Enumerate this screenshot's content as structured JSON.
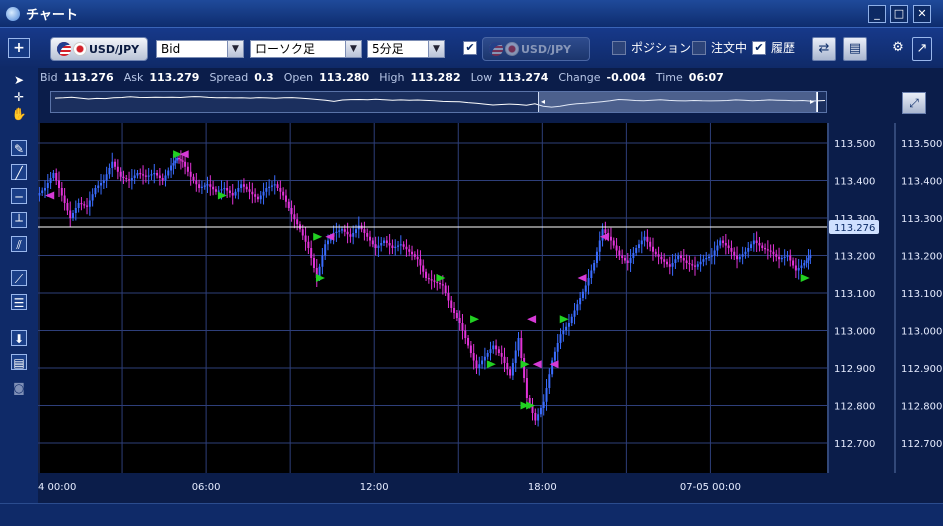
{
  "window": {
    "title": "チャート",
    "controls": [
      "_",
      "□",
      "✕"
    ]
  },
  "toolbar": {
    "add_label": "+",
    "pair_label": "USD/JPY",
    "compare_pair_label": "USD/JPY",
    "price_type": "Bid",
    "chart_type": "ローソク足",
    "timeframe": "5分足",
    "compare_checked": true,
    "position_label": "ポジション",
    "order_label": "注文中",
    "history_label": "履歴",
    "position_checked": false,
    "order_checked": false,
    "history_checked": true
  },
  "quote": {
    "bid_label": "Bid",
    "bid": "113.276",
    "ask_label": "Ask",
    "ask": "113.279",
    "spread_label": "Spread",
    "spread": "0.3",
    "open_label": "Open",
    "open": "113.280",
    "high_label": "High",
    "high": "113.282",
    "low_label": "Low",
    "low": "113.274",
    "change_label": "Change",
    "change": "-0.004",
    "time_label": "Time",
    "time": "06:07"
  },
  "colors": {
    "up_candle": "#3a6cff",
    "down_candle": "#e233d8",
    "buy_marker": "#22d022",
    "sell_marker": "#d63ad6",
    "grid": "#2e3f7a",
    "price_line": "#ffffff",
    "current_tag": "#cfe0ff"
  },
  "chart_data": {
    "type": "candlestick",
    "instrument": "USD/JPY",
    "timeframe": "5分足",
    "x_tick_labels": [
      "4 00:00",
      "06:00",
      "12:00",
      "18:00",
      "07-05 00:00"
    ],
    "y_ticks": [
      113.5,
      113.4,
      113.3,
      113.2,
      113.1,
      113.0,
      112.9,
      112.8,
      112.7
    ],
    "ylim": [
      112.66,
      113.55
    ],
    "current_price": 113.276,
    "current_price_label": "113.276",
    "price_path": [
      [
        0.0,
        113.36
      ],
      [
        0.3,
        113.38
      ],
      [
        0.6,
        113.42
      ],
      [
        0.9,
        113.36
      ],
      [
        1.2,
        113.3
      ],
      [
        1.5,
        113.34
      ],
      [
        1.8,
        113.33
      ],
      [
        2.1,
        113.38
      ],
      [
        2.4,
        113.4
      ],
      [
        2.7,
        113.45
      ],
      [
        3.0,
        113.41
      ],
      [
        3.3,
        113.4
      ],
      [
        3.6,
        113.42
      ],
      [
        3.9,
        113.41
      ],
      [
        4.2,
        113.42
      ],
      [
        4.5,
        113.4
      ],
      [
        4.8,
        113.44
      ],
      [
        5.0,
        113.46
      ],
      [
        5.2,
        113.45
      ],
      [
        5.5,
        113.41
      ],
      [
        5.8,
        113.38
      ],
      [
        6.1,
        113.39
      ],
      [
        6.4,
        113.37
      ],
      [
        6.7,
        113.38
      ],
      [
        7.0,
        113.36
      ],
      [
        7.3,
        113.39
      ],
      [
        7.6,
        113.37
      ],
      [
        7.9,
        113.35
      ],
      [
        8.2,
        113.38
      ],
      [
        8.5,
        113.39
      ],
      [
        8.8,
        113.36
      ],
      [
        9.1,
        113.31
      ],
      [
        9.4,
        113.27
      ],
      [
        9.7,
        113.22
      ],
      [
        10.0,
        113.14
      ],
      [
        10.3,
        113.23
      ],
      [
        10.6,
        113.26
      ],
      [
        10.9,
        113.27
      ],
      [
        11.2,
        113.25
      ],
      [
        11.5,
        113.28
      ],
      [
        11.8,
        113.25
      ],
      [
        12.1,
        113.22
      ],
      [
        12.4,
        113.24
      ],
      [
        12.7,
        113.22
      ],
      [
        13.0,
        113.23
      ],
      [
        13.3,
        113.21
      ],
      [
        13.6,
        113.19
      ],
      [
        13.9,
        113.14
      ],
      [
        14.2,
        113.13
      ],
      [
        14.5,
        113.12
      ],
      [
        14.8,
        113.06
      ],
      [
        15.1,
        113.02
      ],
      [
        15.4,
        112.96
      ],
      [
        15.7,
        112.9
      ],
      [
        16.0,
        112.93
      ],
      [
        16.3,
        112.96
      ],
      [
        16.6,
        112.93
      ],
      [
        16.9,
        112.88
      ],
      [
        17.2,
        112.98
      ],
      [
        17.5,
        112.82
      ],
      [
        17.8,
        112.76
      ],
      [
        18.1,
        112.81
      ],
      [
        18.4,
        112.92
      ],
      [
        18.7,
        112.99
      ],
      [
        19.0,
        113.02
      ],
      [
        19.3,
        113.07
      ],
      [
        19.6,
        113.12
      ],
      [
        19.9,
        113.18
      ],
      [
        20.2,
        113.27
      ],
      [
        20.5,
        113.24
      ],
      [
        20.8,
        113.2
      ],
      [
        21.1,
        113.18
      ],
      [
        21.4,
        113.22
      ],
      [
        21.7,
        113.25
      ],
      [
        22.0,
        113.21
      ],
      [
        22.3,
        113.19
      ],
      [
        22.6,
        113.17
      ],
      [
        22.9,
        113.2
      ],
      [
        23.2,
        113.18
      ],
      [
        23.5,
        113.17
      ],
      [
        23.8,
        113.19
      ],
      [
        24.1,
        113.2
      ],
      [
        24.4,
        113.24
      ],
      [
        24.7,
        113.22
      ],
      [
        25.0,
        113.19
      ],
      [
        25.3,
        113.21
      ],
      [
        25.6,
        113.24
      ],
      [
        25.9,
        113.22
      ],
      [
        26.2,
        113.21
      ],
      [
        26.5,
        113.19
      ],
      [
        26.8,
        113.2
      ],
      [
        27.1,
        113.16
      ],
      [
        27.4,
        113.18
      ],
      [
        27.6,
        113.2
      ]
    ],
    "trade_markers": [
      {
        "side": "sell",
        "t": 0.4,
        "p": 113.36
      },
      {
        "side": "buy",
        "t": 5.0,
        "p": 113.47
      },
      {
        "side": "sell",
        "t": 5.2,
        "p": 113.47
      },
      {
        "side": "buy",
        "t": 6.6,
        "p": 113.36
      },
      {
        "side": "buy",
        "t": 10.0,
        "p": 113.25
      },
      {
        "side": "sell",
        "t": 10.4,
        "p": 113.25
      },
      {
        "side": "buy",
        "t": 10.1,
        "p": 113.14
      },
      {
        "side": "buy",
        "t": 14.4,
        "p": 113.14
      },
      {
        "side": "buy",
        "t": 15.6,
        "p": 113.03
      },
      {
        "side": "buy",
        "t": 16.2,
        "p": 112.91
      },
      {
        "side": "sell",
        "t": 17.6,
        "p": 113.03
      },
      {
        "side": "buy",
        "t": 17.4,
        "p": 112.91
      },
      {
        "side": "sell",
        "t": 17.8,
        "p": 112.91
      },
      {
        "side": "sell",
        "t": 18.4,
        "p": 112.91
      },
      {
        "side": "buy",
        "t": 17.4,
        "p": 112.8
      },
      {
        "side": "buy",
        "t": 17.6,
        "p": 112.8
      },
      {
        "side": "buy",
        "t": 18.8,
        "p": 113.03
      },
      {
        "side": "sell",
        "t": 19.4,
        "p": 113.14
      },
      {
        "side": "sell",
        "t": 20.2,
        "p": 113.25
      },
      {
        "side": "buy",
        "t": 27.4,
        "p": 113.14
      }
    ]
  }
}
